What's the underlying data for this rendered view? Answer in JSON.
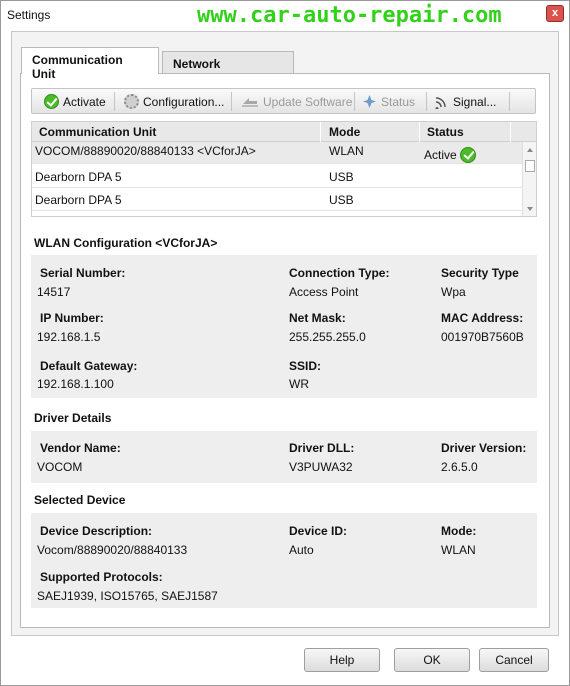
{
  "window": {
    "title": "Settings",
    "watermark": "www.car-auto-repair.com",
    "close_label": "x"
  },
  "tabs": [
    {
      "label": "Communication Unit",
      "active": true
    },
    {
      "label": "Network Connection",
      "active": false
    }
  ],
  "toolbar": {
    "activate": "Activate",
    "configuration": "Configuration...",
    "update_software": "Update Software",
    "status": "Status",
    "signal": "Signal..."
  },
  "grid": {
    "headers": [
      "Communication Unit",
      "Mode",
      "Status"
    ],
    "rows": [
      {
        "unit": "VOCOM/88890020/88840133 <VCforJA>",
        "mode": "WLAN",
        "status": "Active"
      },
      {
        "unit": "Dearborn DPA 5",
        "mode": "USB",
        "status": ""
      },
      {
        "unit": "Dearborn DPA 5",
        "mode": "USB",
        "status": ""
      }
    ]
  },
  "wlan": {
    "title": "WLAN Configuration <VCforJA>",
    "serial_label": "Serial Number:",
    "serial_value": "14517",
    "conn_type_label": "Connection Type:",
    "conn_type_value": "Access Point",
    "sec_type_label": "Security Type",
    "sec_type_value": "Wpa",
    "ip_label": "IP Number:",
    "ip_value": "192.168.1.5",
    "mask_label": "Net Mask:",
    "mask_value": "255.255.255.0",
    "mac_label": "MAC Address:",
    "mac_value": "001970B7560B",
    "gateway_label": "Default Gateway:",
    "gateway_value": "192.168.1.100",
    "ssid_label": "SSID:",
    "ssid_value": "WR"
  },
  "driver": {
    "title": "Driver Details",
    "vendor_label": "Vendor Name:",
    "vendor_value": "VOCOM",
    "dll_label": "Driver DLL:",
    "dll_value": "V3PUWA32",
    "version_label": "Driver Version:",
    "version_value": "2.6.5.0"
  },
  "device": {
    "title": "Selected Device",
    "desc_label": "Device Description:",
    "desc_value": "Vocom/88890020/88840133",
    "id_label": "Device ID:",
    "id_value": "Auto",
    "mode_label": "Mode:",
    "mode_value": "WLAN",
    "protocols_label": "Supported Protocols:",
    "protocols_value": "SAEJ1939, ISO15765, SAEJ1587"
  },
  "footer": {
    "help": "Help",
    "ok": "OK",
    "cancel": "Cancel"
  },
  "colors": {
    "watermark": "#33d11b",
    "active_green": "#4cbb2a",
    "section_bg": "#eeeeee"
  }
}
